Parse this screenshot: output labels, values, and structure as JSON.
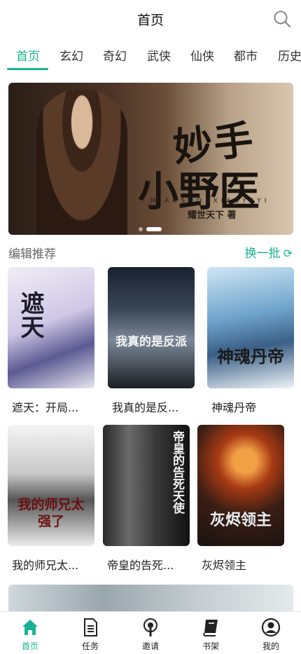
{
  "header": {
    "title": "首页",
    "search_icon": "search-icon"
  },
  "tabs": [
    {
      "label": "首页",
      "active": true
    },
    {
      "label": "玄幻",
      "active": false
    },
    {
      "label": "奇幻",
      "active": false
    },
    {
      "label": "武侠",
      "active": false
    },
    {
      "label": "仙侠",
      "active": false
    },
    {
      "label": "都市",
      "active": false
    },
    {
      "label": "历史",
      "active": false
    }
  ],
  "banner": {
    "title_line1": "妙手",
    "title_line2": "小野医",
    "pinyin": "MIAOSHOUXIAOYEYI",
    "author": "耀世天下 著",
    "active_slide": 2,
    "slide_count": 2
  },
  "recommend": {
    "section_title": "编辑推荐",
    "refresh_label": "换一批",
    "refresh_icon": "refresh-icon",
    "books": [
      {
        "title": "遮天：开局...",
        "cover_text": "遮天"
      },
      {
        "title": "我真的是反...",
        "cover_text": "我真的是反派"
      },
      {
        "title": "神魂丹帝",
        "cover_text": "神魂丹帝"
      },
      {
        "title": "我的师兄太...",
        "cover_text": "我的师兄太强了"
      },
      {
        "title": "帝皇的告死...",
        "cover_text": "帝皇的告死天使"
      },
      {
        "title": "灰烬领主",
        "cover_text": "灰烬领主"
      }
    ]
  },
  "bottom_nav": [
    {
      "label": "首页",
      "icon": "home-icon",
      "active": true
    },
    {
      "label": "任务",
      "icon": "task-icon",
      "active": false
    },
    {
      "label": "邀请",
      "icon": "invite-icon",
      "active": false
    },
    {
      "label": "书架",
      "icon": "bookshelf-icon",
      "active": false
    },
    {
      "label": "我的",
      "icon": "profile-icon",
      "active": false
    }
  ],
  "colors": {
    "accent": "#19b394",
    "text": "#222222",
    "muted": "#666666"
  }
}
